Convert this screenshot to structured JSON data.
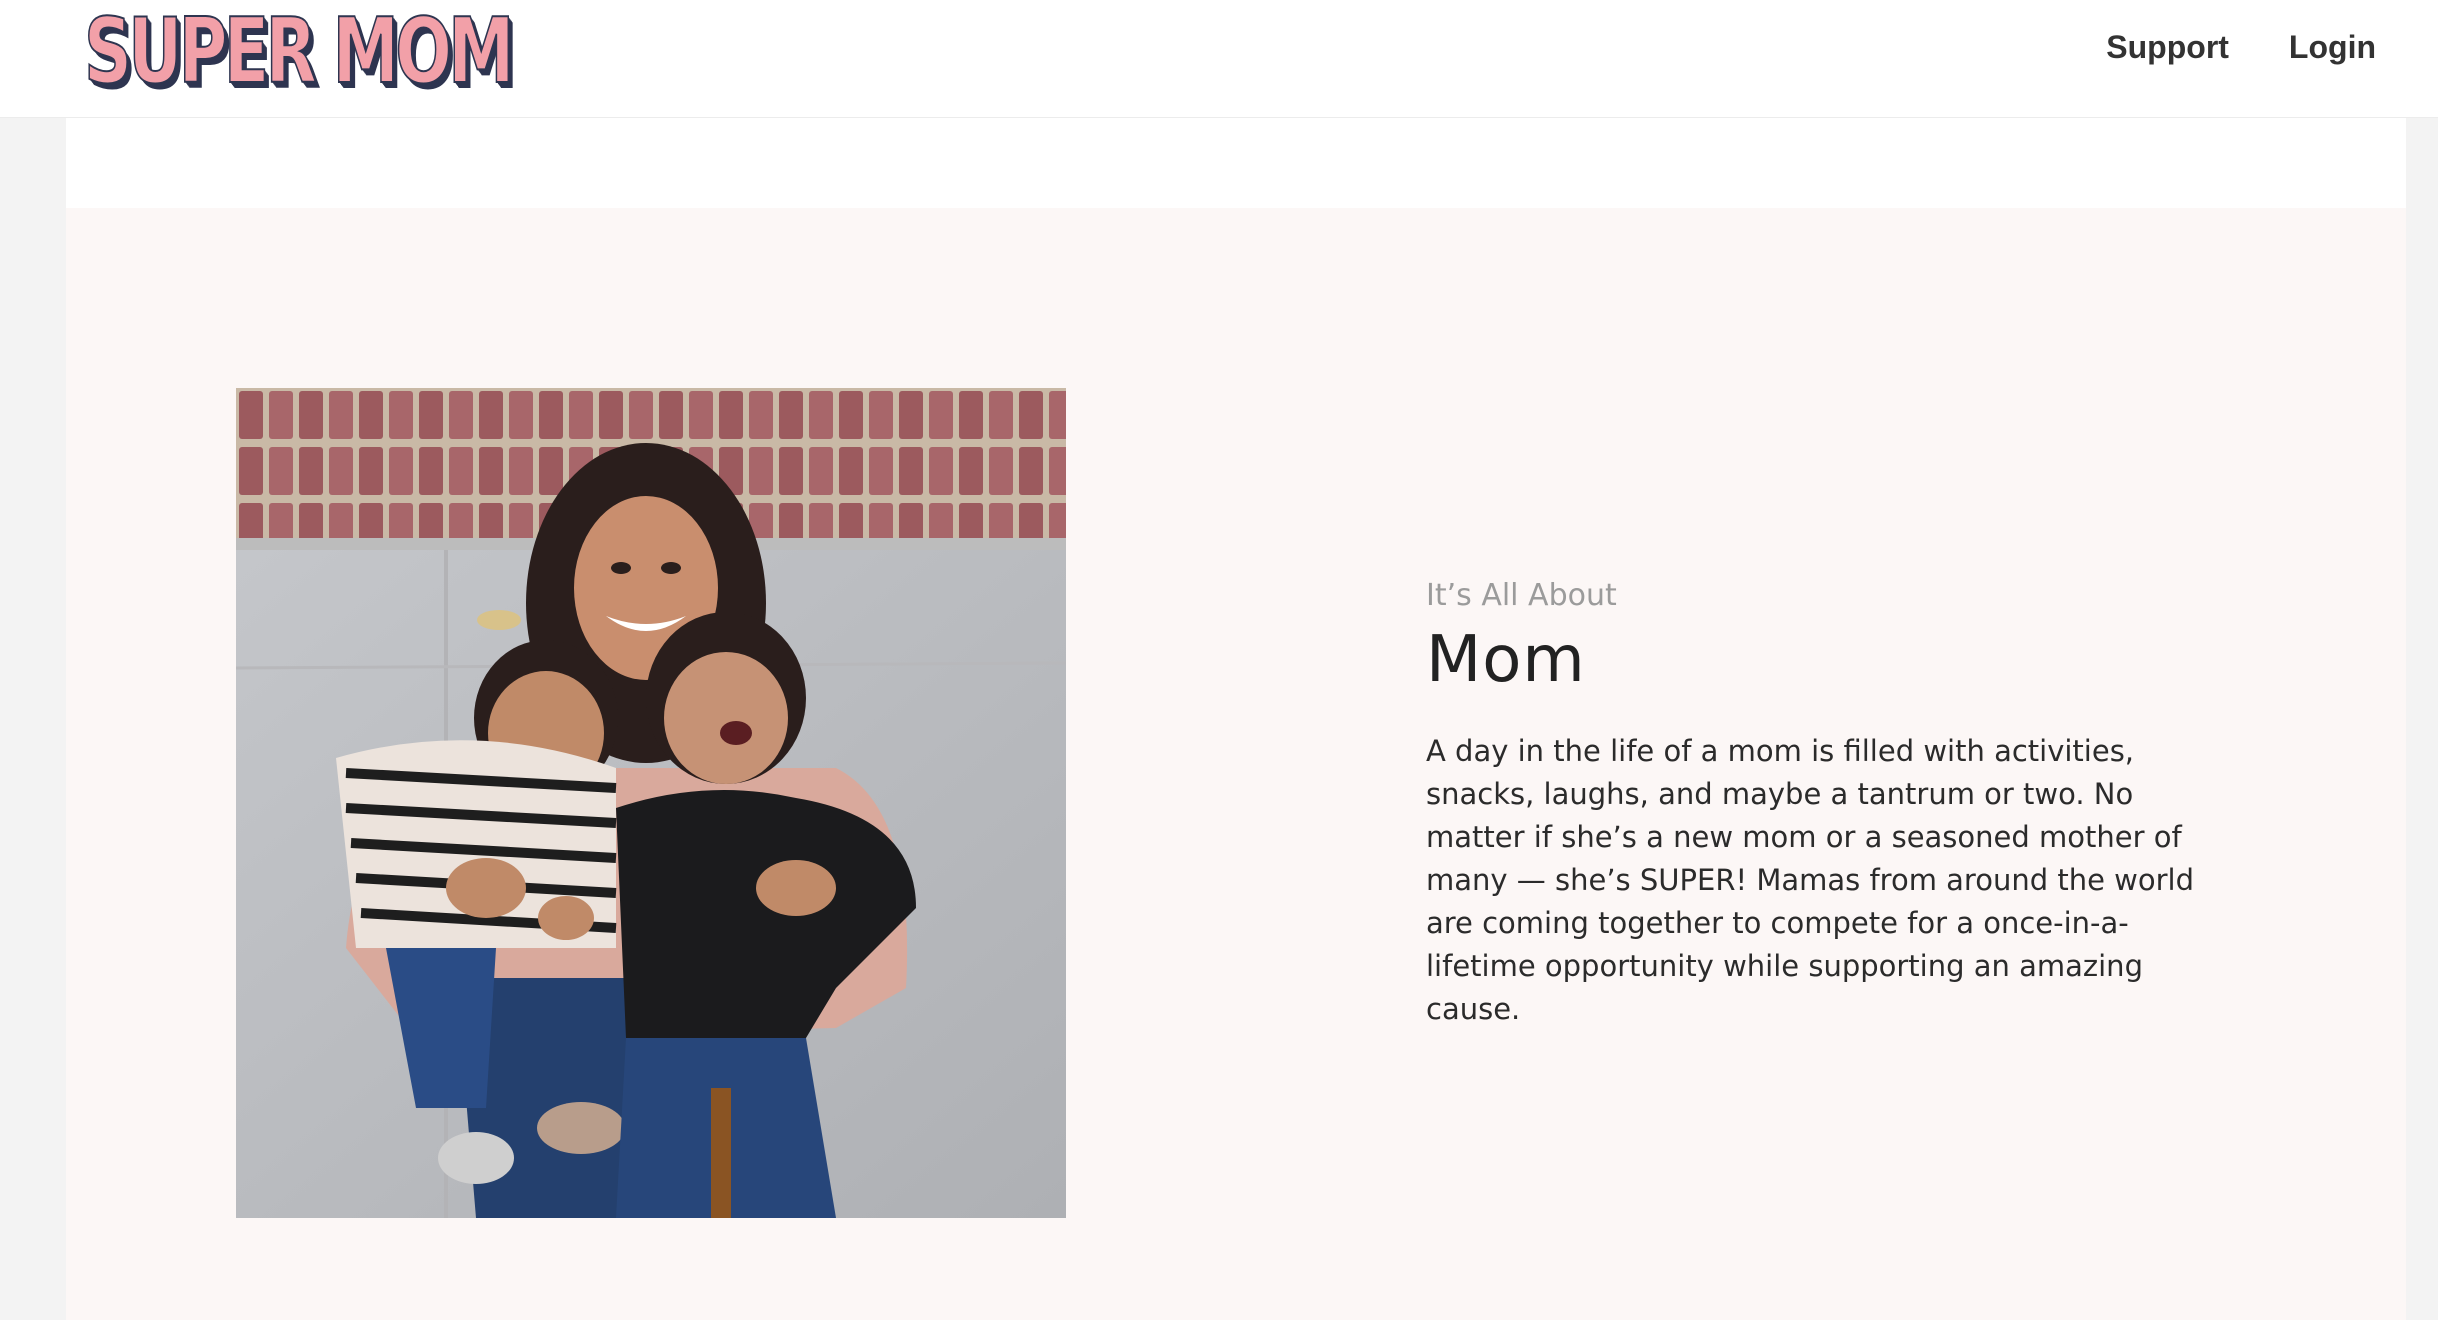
{
  "header": {
    "logo_text": "SUPER MOM",
    "nav": [
      {
        "label": "Support"
      },
      {
        "label": "Login"
      }
    ]
  },
  "about": {
    "eyebrow": "It’s All About",
    "heading": "Mom",
    "body": "A day in the life of a mom is filled with activities, snacks, laughs, and maybe a tantrum or two. No matter if she’s a new mom or a seasoned mother of many — she’s SUPER! Mamas from around the world are coming together to compete for a once-in-a-lifetime opportunity while supporting an amazing cause."
  },
  "colors": {
    "logo_fill": "#f2a0a8",
    "logo_outline": "#2e3550",
    "section_background": "#fcf7f6",
    "page_background": "#f3f3f3"
  },
  "icons": [
    "photo-mom-and-toddlers"
  ]
}
